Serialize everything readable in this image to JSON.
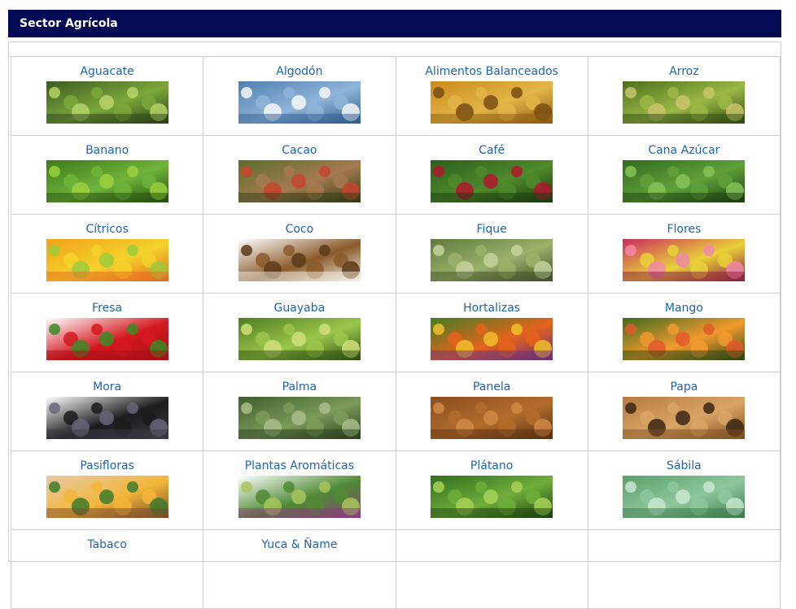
{
  "header": {
    "title": "Sector Agrícola"
  },
  "grid": {
    "rows": [
      [
        {
          "label": "Aguacate",
          "icon": "aguacate-image",
          "colors": [
            "#3d5b22",
            "#7aa83a",
            "#2a3f18"
          ],
          "accent": "#b7d46a"
        },
        {
          "label": "Algodón",
          "icon": "algodon-image",
          "colors": [
            "#4f7fb3",
            "#8fb5d8",
            "#2f5d8d"
          ],
          "accent": "#f7f7f7"
        },
        {
          "label": "Alimentos Balanceados",
          "icon": "alimentos-balanceados-image",
          "colors": [
            "#c98b1a",
            "#e3b547",
            "#8d5b12"
          ],
          "accent": "#7a4d13"
        },
        {
          "label": "Arroz",
          "icon": "arroz-image",
          "colors": [
            "#4d6f1c",
            "#9ab845",
            "#2f4a12"
          ],
          "accent": "#c9c46a"
        }
      ],
      [
        {
          "label": "Banano",
          "icon": "banano-image",
          "colors": [
            "#3d7a1c",
            "#6fb43a",
            "#244f10"
          ],
          "accent": "#9bd13e"
        },
        {
          "label": "Cacao",
          "icon": "cacao-image",
          "colors": [
            "#5b6e2a",
            "#a57a4f",
            "#2f3c15"
          ],
          "accent": "#c6452e"
        },
        {
          "label": "Café",
          "icon": "cafe-image",
          "colors": [
            "#2d5e1c",
            "#4f8a2c",
            "#1a3a0f"
          ],
          "accent": "#b0162e"
        },
        {
          "label": "Cana Azúcar",
          "icon": "cana-azucar-image",
          "colors": [
            "#2f6a1e",
            "#5fa13a",
            "#1a3d10"
          ],
          "accent": "#86c257"
        }
      ],
      [
        {
          "label": "Cítricos",
          "icon": "citricos-image",
          "colors": [
            "#f2a11a",
            "#f4d22c",
            "#e66a1f"
          ],
          "accent": "#9ccb3b"
        },
        {
          "label": "Coco",
          "icon": "coco-image",
          "colors": [
            "#ffffff",
            "#8a5a2b",
            "#f4f0e6"
          ],
          "accent": "#5d3a17"
        },
        {
          "label": "Fique",
          "icon": "fique-image",
          "colors": [
            "#5f7b3d",
            "#9ab26a",
            "#3e5226"
          ],
          "accent": "#c6d29b"
        },
        {
          "label": "Flores",
          "icon": "flores-image",
          "colors": [
            "#c82c5e",
            "#e9d13a",
            "#8a1d3d"
          ],
          "accent": "#f08aa6"
        }
      ],
      [
        {
          "label": "Fresa",
          "icon": "fresa-image",
          "colors": [
            "#ffffff",
            "#d3181f",
            "#a80e15"
          ],
          "accent": "#3c8a24"
        },
        {
          "label": "Guayaba",
          "icon": "guayaba-image",
          "colors": [
            "#4f7d22",
            "#9bc64c",
            "#2f4f12"
          ],
          "accent": "#cfe07a"
        },
        {
          "label": "Hortalizas",
          "icon": "hortalizas-image",
          "colors": [
            "#3f7f25",
            "#e5631c",
            "#6b2f7a"
          ],
          "accent": "#f0c02a"
        },
        {
          "label": "Mango",
          "icon": "mango-image",
          "colors": [
            "#3c6b1d",
            "#f29a2f",
            "#2a4812"
          ],
          "accent": "#e25a2a"
        }
      ],
      [
        {
          "label": "Mora",
          "icon": "mora-image",
          "colors": [
            "#ffffff",
            "#1b1b1f",
            "#3a3a44"
          ],
          "accent": "#66667a"
        },
        {
          "label": "Palma",
          "icon": "palma-image",
          "colors": [
            "#3d5e2c",
            "#7b9a5a",
            "#27401c"
          ],
          "accent": "#a9bd88"
        },
        {
          "label": "Panela",
          "icon": "panela-image",
          "colors": [
            "#8a4d1e",
            "#b36c2c",
            "#5c2f10"
          ],
          "accent": "#d08a45"
        },
        {
          "label": "Papa",
          "icon": "papa-image",
          "colors": [
            "#b57b3f",
            "#d9a565",
            "#7f4f22"
          ],
          "accent": "#3a2614"
        }
      ],
      [
        {
          "label": "Pasifloras",
          "icon": "pasifloras-image",
          "colors": [
            "#e8c9a8",
            "#f3b63a",
            "#7a4a2b"
          ],
          "accent": "#3e7a2b"
        },
        {
          "label": "Plantas Aromáticas",
          "icon": "plantas-aromaticas-image",
          "colors": [
            "#ffffff",
            "#4f8a34",
            "#8a3e7b"
          ],
          "accent": "#a8c65c"
        },
        {
          "label": "Plátano",
          "icon": "platano-image",
          "colors": [
            "#2f6e1f",
            "#6fae3a",
            "#1b4210"
          ],
          "accent": "#a8d257"
        },
        {
          "label": "Sábila",
          "icon": "sabila-image",
          "colors": [
            "#5b9f6a",
            "#8fc79c",
            "#3b7a4b"
          ],
          "accent": "#c9e6cf"
        }
      ],
      [
        {
          "label": "Tabaco",
          "icon": "tabaco-image",
          "colors": [],
          "accent": ""
        },
        {
          "label": "Yuca & Ñame",
          "icon": "yuca-name-image",
          "colors": [],
          "accent": ""
        },
        {
          "label": "",
          "icon": "",
          "colors": [],
          "accent": ""
        },
        {
          "label": "",
          "icon": "",
          "colors": [],
          "accent": ""
        }
      ]
    ]
  }
}
